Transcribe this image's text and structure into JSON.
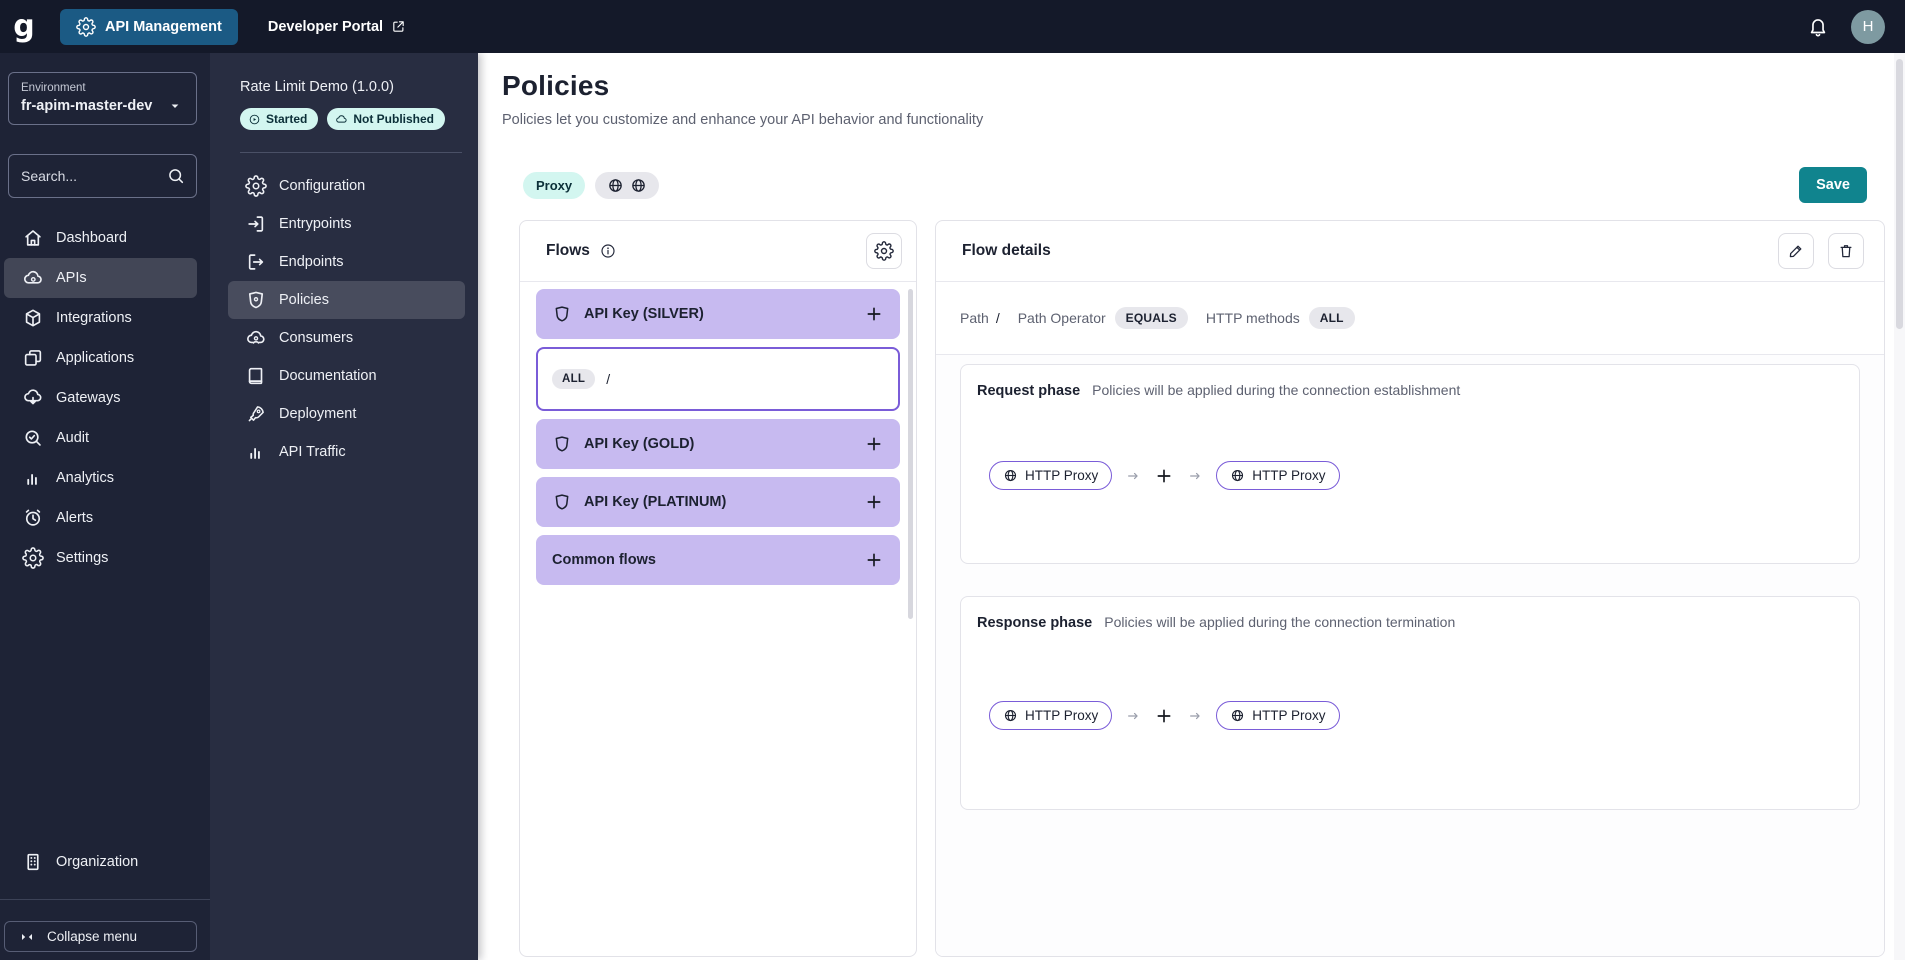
{
  "topbar": {
    "logo": "g",
    "product_label": "API Management",
    "portal_label": "Developer Portal",
    "avatar_initial": "H"
  },
  "sidebar": {
    "environment_label": "Environment",
    "environment_value": "fr-apim-master-dev",
    "search_placeholder": "Search...",
    "items": [
      {
        "label": "Dashboard",
        "icon": "home-icon",
        "active": false
      },
      {
        "label": "APIs",
        "icon": "cloud-gear-icon",
        "active": true
      },
      {
        "label": "Integrations",
        "icon": "package-icon",
        "active": false
      },
      {
        "label": "Applications",
        "icon": "applications-icon",
        "active": false
      },
      {
        "label": "Gateways",
        "icon": "cloud-arrow-icon",
        "active": false
      },
      {
        "label": "Audit",
        "icon": "search-check-icon",
        "active": false
      },
      {
        "label": "Analytics",
        "icon": "bar-chart-icon",
        "active": false
      },
      {
        "label": "Alerts",
        "icon": "alarm-clock-icon",
        "active": false
      },
      {
        "label": "Settings",
        "icon": "gear-icon",
        "active": false
      }
    ],
    "organization_label": "Organization",
    "collapse_label": "Collapse menu"
  },
  "api_menu": {
    "api_title": "Rate Limit Demo (1.0.0)",
    "status_badge": "Started",
    "publish_badge": "Not Published",
    "items": [
      {
        "label": "Configuration",
        "icon": "gear-icon",
        "active": false
      },
      {
        "label": "Entrypoints",
        "icon": "enter-icon",
        "active": false
      },
      {
        "label": "Endpoints",
        "icon": "exit-icon",
        "active": false
      },
      {
        "label": "Policies",
        "icon": "shield-icon",
        "active": true
      },
      {
        "label": "Consumers",
        "icon": "cloud-user-icon",
        "active": false
      },
      {
        "label": "Documentation",
        "icon": "book-icon",
        "active": false
      },
      {
        "label": "Deployment",
        "icon": "rocket-icon",
        "active": false
      },
      {
        "label": "API Traffic",
        "icon": "bar-chart-icon",
        "active": false
      }
    ]
  },
  "page": {
    "title": "Policies",
    "subtitle": "Policies let you customize and enhance your API behavior and functionality",
    "proxy_badge": "Proxy",
    "save_label": "Save"
  },
  "flows": {
    "title": "Flows",
    "groups": [
      {
        "label": "API Key (SILVER)",
        "shield": true
      },
      {
        "label": "API Key (GOLD)",
        "shield": true
      },
      {
        "label": "API Key (PLATINUM)",
        "shield": true
      },
      {
        "label": "Common flows",
        "shield": false
      }
    ],
    "selected_flow": {
      "method": "ALL",
      "path": "/"
    }
  },
  "flow_details": {
    "title": "Flow details",
    "condition": {
      "path_label": "Path",
      "path_value": "/",
      "operator_label": "Path Operator",
      "operator_value": "EQUALS",
      "methods_label": "HTTP methods",
      "methods_value": "ALL"
    },
    "request_phase": {
      "name": "Request phase",
      "description": "Policies will be applied during the connection establishment",
      "policies": [
        "HTTP Proxy",
        "HTTP Proxy"
      ]
    },
    "response_phase": {
      "name": "Response phase",
      "description": "Policies will be applied during the connection termination",
      "policies": [
        "HTTP Proxy",
        "HTTP Proxy"
      ]
    }
  },
  "colors": {
    "topbar_bg": "#141929",
    "sidebar_bg": "#1e2336",
    "api_sidebar_bg": "#282d41",
    "accent_blue": "#1b5a84",
    "accent_teal": "#10848e",
    "badge_mint": "#d3f6f0",
    "flow_purple": "#c7baf0",
    "selected_purple": "#7a5cd8",
    "pill_gray": "#e7e7ec"
  }
}
